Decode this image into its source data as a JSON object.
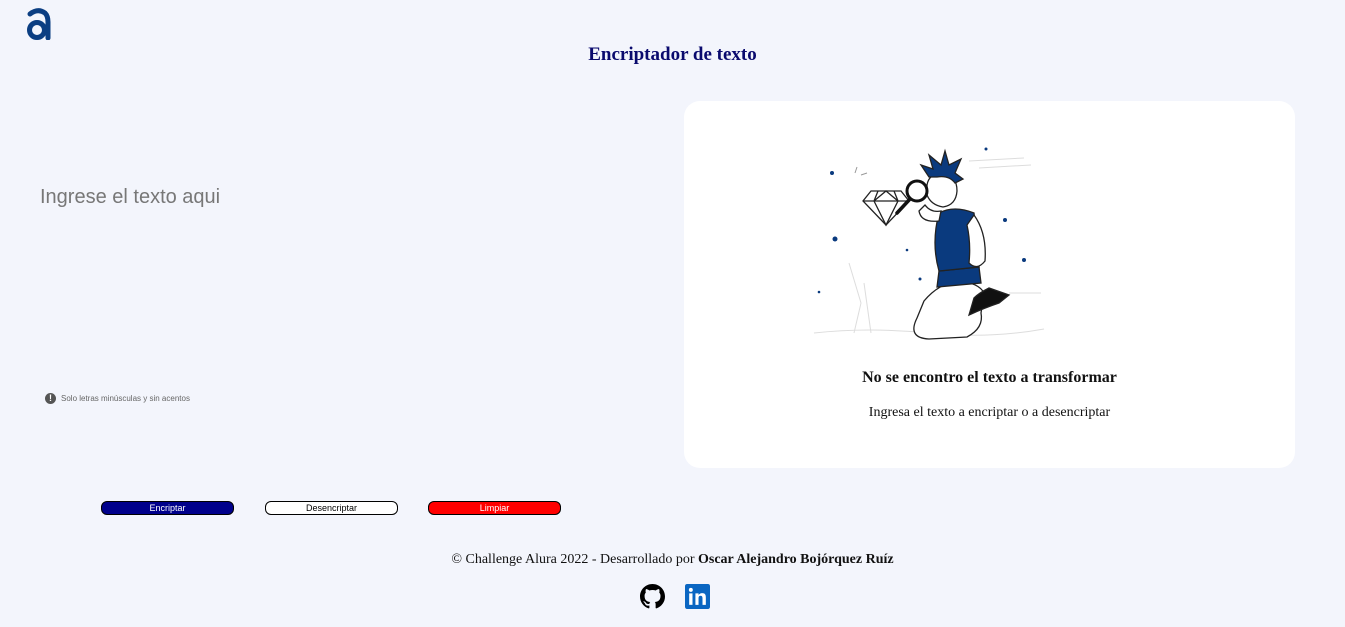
{
  "header": {
    "title": "Encriptador de texto",
    "logo_icon": "alura-logo-icon"
  },
  "input": {
    "placeholder": "Ingrese el texto aqui",
    "value": "",
    "hint": "Solo letras minúsculas y sin acentos",
    "hint_icon": "info-icon"
  },
  "result": {
    "title": "No se encontro el texto a transformar",
    "subtitle": "Ingresa el texto a encriptar o a desencriptar",
    "illustration_icon": "person-with-magnifier-illustration"
  },
  "buttons": {
    "encrypt": "Encriptar",
    "decrypt": "Desencriptar",
    "clear": "Limpiar"
  },
  "footer": {
    "text_prefix": "© Challenge Alura 2022 - Desarrollado por ",
    "author": "Oscar Alejandro Bojórquez Ruíz",
    "github_icon": "github-icon",
    "linkedin_icon": "linkedin-icon"
  },
  "colors": {
    "background": "#f3f5fc",
    "title": "#0a0a6e",
    "encrypt_button": "#00008b",
    "clear_button": "#ff0000",
    "linkedin": "#0a66c2",
    "illustration_accent": "#0a3a7e"
  }
}
